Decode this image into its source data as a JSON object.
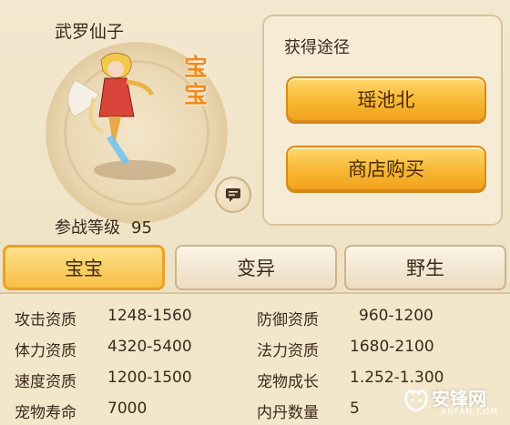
{
  "pet": {
    "name": "武罗仙子",
    "badge": "宝宝",
    "level_label": "参战等级",
    "level_value": "95"
  },
  "source": {
    "title": "获得途径",
    "buttons": [
      "瑶池北",
      "商店购买"
    ]
  },
  "tabs": [
    "宝宝",
    "变异",
    "野生"
  ],
  "stats": {
    "left": [
      {
        "label": "攻击资质",
        "value": "1248-1560"
      },
      {
        "label": "体力资质",
        "value": "4320-5400"
      },
      {
        "label": "速度资质",
        "value": "1200-1500"
      },
      {
        "label": "宠物寿命",
        "value": "7000"
      }
    ],
    "right": [
      {
        "label": "防御资质",
        "value": "960-1200"
      },
      {
        "label": "法力资质",
        "value": "1680-2100"
      },
      {
        "label": "宠物成长",
        "value": "1.252-1.300"
      },
      {
        "label": "内丹数量",
        "value": "5"
      }
    ]
  },
  "watermark": {
    "main": "安锋网",
    "sub": "ANFAN.COM"
  },
  "icons": {
    "chat": "chat-bubble-icon"
  },
  "colors": {
    "accent": "#f7b52f",
    "badge": "#f28a1d"
  }
}
